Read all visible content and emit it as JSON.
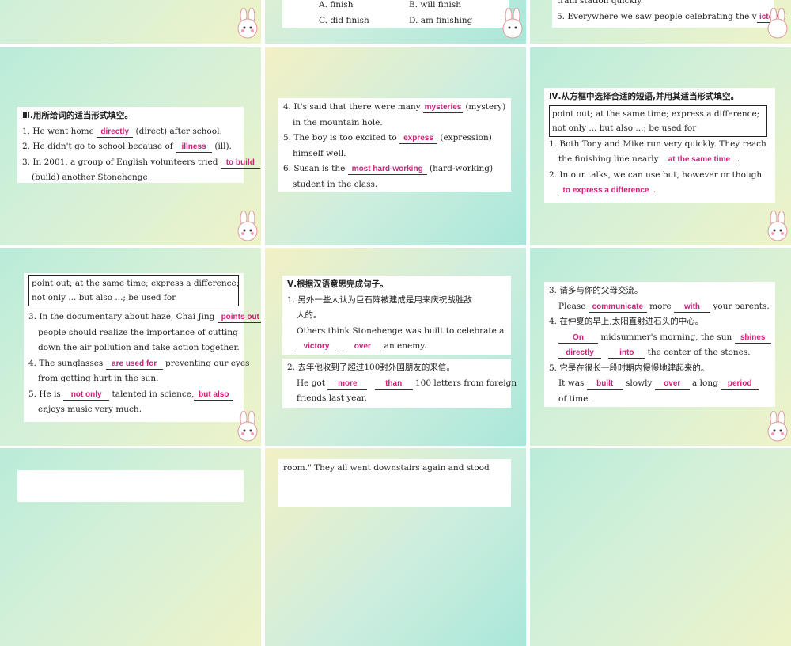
{
  "t1": {
    "options_a": "A. finish",
    "options_b": "B. will finish",
    "options_c": "C. did finish",
    "options_d": "D. am finishing"
  },
  "t2": {
    "partial_top": "train station quickly.",
    "line5_pre": "5. Everywhere we saw people celebrating the v",
    "line5_ans": "ictory",
    "line5_post": "."
  },
  "t3": {
    "heading": "Ⅲ.用所给词的适当形式填空。",
    "l1_pre": "1. He went home ",
    "l1_ans": "directly",
    "l1_post": " (direct) after school.",
    "l2_pre": "2. He didn't go to school because of ",
    "l2_ans": "illness",
    "l2_post": " (ill).",
    "l3_pre": "3. In 2001, a group of English volunteers tried ",
    "l3_ans": "to build",
    "l3_cont": "(build) another Stonehenge."
  },
  "t4": {
    "l4_pre": "4. It's said that there were many ",
    "l4_ans": "mysteries",
    "l4_post": " (mystery)",
    "l4_cont": "in the mountain hole.",
    "l5_pre": "5. The boy is too excited to ",
    "l5_ans": "express",
    "l5_post": " (expression)",
    "l5_cont": "himself well.",
    "l6_pre": "6. Susan is the ",
    "l6_ans": "most hard-working",
    "l6_post": " (hard-working)",
    "l6_cont": "student in the class."
  },
  "t5": {
    "heading": "Ⅳ.从方框中选择合适的短语,并用其适当形式填空。",
    "box1": "point out; at the same time; express a difference;",
    "box2": "not only ... but also ...; be used for",
    "l1_pre": "1. Both Tony and Mike run very quickly. They reach",
    "l1_cont_pre": "the finishing line nearly ",
    "l1_ans": "at the same time",
    "l1_post": ".",
    "l2_pre": "2. In our talks, we can use but, however or though",
    "l2_ans": "to express a difference",
    "l2_post": "."
  },
  "t6": {
    "box1": "point out; at the same time; express a difference;",
    "box2": "not only ... but also ...; be used for",
    "l3_pre": "3. In the documentary about haze, Chai Jing ",
    "l3_ans": "points out",
    "l3_post": ",",
    "l3_c1": "people should realize the importance of cutting",
    "l3_c2": "down the air pollution and take action together.",
    "l4_pre": "4. The sunglasses ",
    "l4_ans": "are used for",
    "l4_post": " preventing our eyes",
    "l4_c1": "from getting hurt in the sun.",
    "l5_pre": "5. He is ",
    "l5_ans1": "not only",
    "l5_mid": " talented in science,",
    "l5_ans2": "but also",
    "l5_c1": "enjoys music very much."
  },
  "t7": {
    "heading": "Ⅴ.根据汉语意思完成句子。",
    "l1_cn": "1. 另外一些人认为巨石阵被建成是用来庆祝战胜敌",
    "l1_cn2": "人的。",
    "l1_en": "Others think Stonehenge was built to celebrate a",
    "l1_ans1": "victory",
    "l1_ans2": "over",
    "l1_post": " an enemy.",
    "l2_cn": "2. 去年他收到了超过100封外国朋友的来信。",
    "l2_pre": "He got ",
    "l2_ans1": "more",
    "l2_ans2": "than",
    "l2_post": " 100 letters from foreign",
    "l2_cont": "friends last year."
  },
  "t8": {
    "l3_cn": "3. 请多与你的父母交流。",
    "l3_pre": "Please ",
    "l3_ans1": "communicate",
    "l3_mid": " more ",
    "l3_ans2": "with",
    "l3_post": " your parents.",
    "l4_cn": "4. 在仲夏的早上,太阳直射进石头的中心。",
    "l4_ans1": "On",
    "l4_mid": " midsummer's morning, the sun ",
    "l4_ans2": "shines",
    "l4_ans3": "directly",
    "l4_ans4": "into",
    "l4_post": " the center of the stones.",
    "l5_cn": "5. 它是在很长一段时期内慢慢地建起来的。",
    "l5_pre": "It was ",
    "l5_ans1": "built",
    "l5_mid": " slowly ",
    "l5_ans2": "over",
    "l5_mid2": " a long ",
    "l5_ans3": "period",
    "l5_cont": "of time."
  },
  "t11": {
    "partial": "room.\" They all went downstairs again and stood"
  },
  "colors": {
    "answer": "#d0207a",
    "tile_green": "#b9ecd9",
    "tile_yellow": "#eef3c8"
  }
}
